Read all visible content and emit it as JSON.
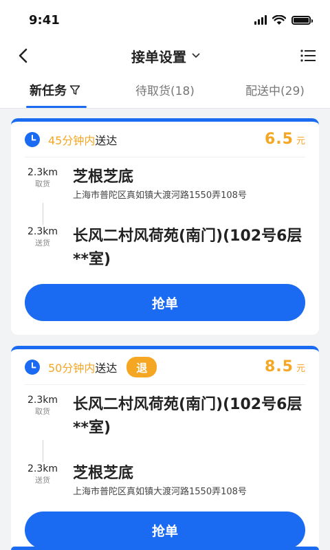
{
  "status": {
    "time": "9:41"
  },
  "nav": {
    "title": "接单设置"
  },
  "tabs": [
    {
      "label": "新任务"
    },
    {
      "label": "待取货(18)"
    },
    {
      "label": "配送中(29)"
    }
  ],
  "colors": {
    "primary": "#1a6bf2",
    "accent": "#f5a623"
  },
  "orders": [
    {
      "deadline": "45分钟内",
      "deadline_suffix": "送达",
      "price": "6.5",
      "price_unit": "元",
      "stops": [
        {
          "distance": "2.3km",
          "kind": "取货",
          "name": "芝根芝底",
          "address": "上海市普陀区真如镇大渡河路1550弄108号"
        },
        {
          "distance": "2.3km",
          "kind": "送货",
          "name": "长风二村风荷苑(南门)(102号6层**室)",
          "address": ""
        }
      ],
      "button": "抢单"
    },
    {
      "deadline": "50分钟内",
      "deadline_suffix": "送达",
      "badge": "退",
      "price": "8.5",
      "price_unit": "元",
      "stops": [
        {
          "distance": "2.3km",
          "kind": "取货",
          "name": "长风二村风荷苑(南门)(102号6层**室)",
          "address": ""
        },
        {
          "distance": "2.3km",
          "kind": "送货",
          "name": "芝根芝底",
          "address": "上海市普陀区真如镇大渡河路1550弄108号"
        }
      ],
      "button": "抢单"
    }
  ]
}
